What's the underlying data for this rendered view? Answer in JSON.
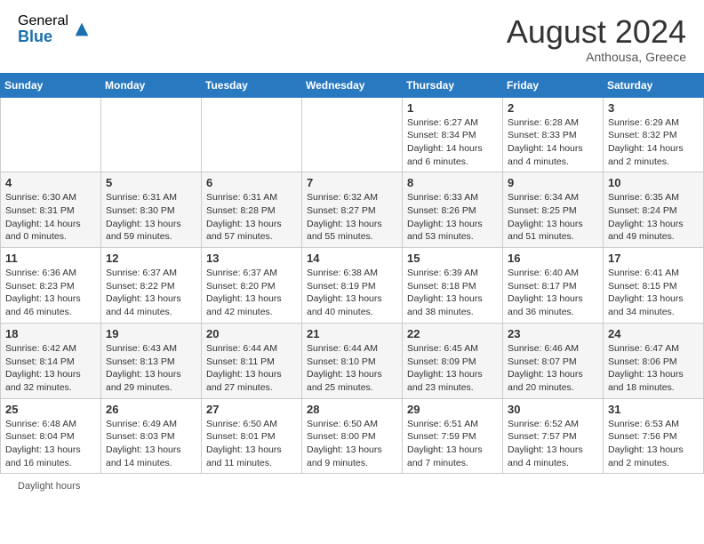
{
  "header": {
    "logo_general": "General",
    "logo_blue": "Blue",
    "month": "August 2024",
    "location": "Anthousa, Greece"
  },
  "calendar": {
    "days_of_week": [
      "Sunday",
      "Monday",
      "Tuesday",
      "Wednesday",
      "Thursday",
      "Friday",
      "Saturday"
    ],
    "weeks": [
      [
        {
          "day": "",
          "info": ""
        },
        {
          "day": "",
          "info": ""
        },
        {
          "day": "",
          "info": ""
        },
        {
          "day": "",
          "info": ""
        },
        {
          "day": "1",
          "info": "Sunrise: 6:27 AM\nSunset: 8:34 PM\nDaylight: 14 hours and 6 minutes."
        },
        {
          "day": "2",
          "info": "Sunrise: 6:28 AM\nSunset: 8:33 PM\nDaylight: 14 hours and 4 minutes."
        },
        {
          "day": "3",
          "info": "Sunrise: 6:29 AM\nSunset: 8:32 PM\nDaylight: 14 hours and 2 minutes."
        }
      ],
      [
        {
          "day": "4",
          "info": "Sunrise: 6:30 AM\nSunset: 8:31 PM\nDaylight: 14 hours and 0 minutes."
        },
        {
          "day": "5",
          "info": "Sunrise: 6:31 AM\nSunset: 8:30 PM\nDaylight: 13 hours and 59 minutes."
        },
        {
          "day": "6",
          "info": "Sunrise: 6:31 AM\nSunset: 8:28 PM\nDaylight: 13 hours and 57 minutes."
        },
        {
          "day": "7",
          "info": "Sunrise: 6:32 AM\nSunset: 8:27 PM\nDaylight: 13 hours and 55 minutes."
        },
        {
          "day": "8",
          "info": "Sunrise: 6:33 AM\nSunset: 8:26 PM\nDaylight: 13 hours and 53 minutes."
        },
        {
          "day": "9",
          "info": "Sunrise: 6:34 AM\nSunset: 8:25 PM\nDaylight: 13 hours and 51 minutes."
        },
        {
          "day": "10",
          "info": "Sunrise: 6:35 AM\nSunset: 8:24 PM\nDaylight: 13 hours and 49 minutes."
        }
      ],
      [
        {
          "day": "11",
          "info": "Sunrise: 6:36 AM\nSunset: 8:23 PM\nDaylight: 13 hours and 46 minutes."
        },
        {
          "day": "12",
          "info": "Sunrise: 6:37 AM\nSunset: 8:22 PM\nDaylight: 13 hours and 44 minutes."
        },
        {
          "day": "13",
          "info": "Sunrise: 6:37 AM\nSunset: 8:20 PM\nDaylight: 13 hours and 42 minutes."
        },
        {
          "day": "14",
          "info": "Sunrise: 6:38 AM\nSunset: 8:19 PM\nDaylight: 13 hours and 40 minutes."
        },
        {
          "day": "15",
          "info": "Sunrise: 6:39 AM\nSunset: 8:18 PM\nDaylight: 13 hours and 38 minutes."
        },
        {
          "day": "16",
          "info": "Sunrise: 6:40 AM\nSunset: 8:17 PM\nDaylight: 13 hours and 36 minutes."
        },
        {
          "day": "17",
          "info": "Sunrise: 6:41 AM\nSunset: 8:15 PM\nDaylight: 13 hours and 34 minutes."
        }
      ],
      [
        {
          "day": "18",
          "info": "Sunrise: 6:42 AM\nSunset: 8:14 PM\nDaylight: 13 hours and 32 minutes."
        },
        {
          "day": "19",
          "info": "Sunrise: 6:43 AM\nSunset: 8:13 PM\nDaylight: 13 hours and 29 minutes."
        },
        {
          "day": "20",
          "info": "Sunrise: 6:44 AM\nSunset: 8:11 PM\nDaylight: 13 hours and 27 minutes."
        },
        {
          "day": "21",
          "info": "Sunrise: 6:44 AM\nSunset: 8:10 PM\nDaylight: 13 hours and 25 minutes."
        },
        {
          "day": "22",
          "info": "Sunrise: 6:45 AM\nSunset: 8:09 PM\nDaylight: 13 hours and 23 minutes."
        },
        {
          "day": "23",
          "info": "Sunrise: 6:46 AM\nSunset: 8:07 PM\nDaylight: 13 hours and 20 minutes."
        },
        {
          "day": "24",
          "info": "Sunrise: 6:47 AM\nSunset: 8:06 PM\nDaylight: 13 hours and 18 minutes."
        }
      ],
      [
        {
          "day": "25",
          "info": "Sunrise: 6:48 AM\nSunset: 8:04 PM\nDaylight: 13 hours and 16 minutes."
        },
        {
          "day": "26",
          "info": "Sunrise: 6:49 AM\nSunset: 8:03 PM\nDaylight: 13 hours and 14 minutes."
        },
        {
          "day": "27",
          "info": "Sunrise: 6:50 AM\nSunset: 8:01 PM\nDaylight: 13 hours and 11 minutes."
        },
        {
          "day": "28",
          "info": "Sunrise: 6:50 AM\nSunset: 8:00 PM\nDaylight: 13 hours and 9 minutes."
        },
        {
          "day": "29",
          "info": "Sunrise: 6:51 AM\nSunset: 7:59 PM\nDaylight: 13 hours and 7 minutes."
        },
        {
          "day": "30",
          "info": "Sunrise: 6:52 AM\nSunset: 7:57 PM\nDaylight: 13 hours and 4 minutes."
        },
        {
          "day": "31",
          "info": "Sunrise: 6:53 AM\nSunset: 7:56 PM\nDaylight: 13 hours and 2 minutes."
        }
      ]
    ]
  },
  "footer": {
    "note": "Daylight hours"
  }
}
